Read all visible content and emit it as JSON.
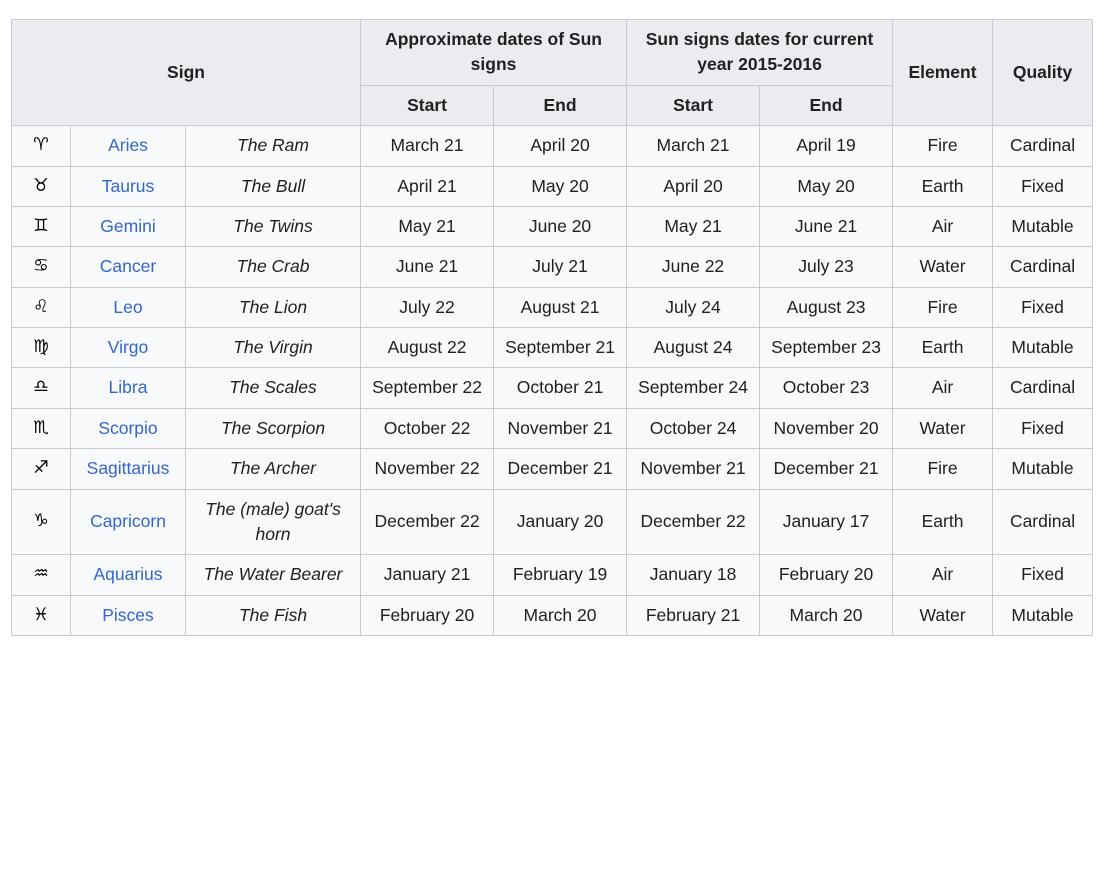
{
  "table": {
    "headers": {
      "sign": "Sign",
      "approx_dates": "Approximate dates of Sun signs",
      "current_year_dates": "Sun signs dates for current year 2015-2016",
      "element": "Element",
      "quality": "Quality",
      "approx_start": "Start",
      "approx_end": "End",
      "current_start": "Start",
      "current_end": "End"
    },
    "colors": {
      "link": "#3366cc",
      "header_bg": "#eaecf0",
      "cell_bg": "#f8f9fa",
      "outer_border": "#a2a9b1",
      "inner_border": "#c8ccd1",
      "text": "#202122"
    },
    "rows": [
      {
        "glyph": "♈",
        "glyph_name": "aries-symbol",
        "sign": "Aries",
        "meaning": "The Ram",
        "approx_start": "March 21",
        "approx_end": "April 20",
        "current_start": "March 21",
        "current_end": "April 19",
        "element": "Fire",
        "quality": "Cardinal"
      },
      {
        "glyph": "♉",
        "glyph_name": "taurus-symbol",
        "sign": "Taurus",
        "meaning": "The Bull",
        "approx_start": "April 21",
        "approx_end": "May 20",
        "current_start": "April 20",
        "current_end": "May 20",
        "element": "Earth",
        "quality": "Fixed"
      },
      {
        "glyph": "♊",
        "glyph_name": "gemini-symbol",
        "sign": "Gemini",
        "meaning": "The Twins",
        "approx_start": "May 21",
        "approx_end": "June 20",
        "current_start": "May 21",
        "current_end": "June 21",
        "element": "Air",
        "quality": "Mutable"
      },
      {
        "glyph": "♋",
        "glyph_name": "cancer-symbol",
        "sign": "Cancer",
        "meaning": "The Crab",
        "approx_start": "June 21",
        "approx_end": "July 21",
        "current_start": "June 22",
        "current_end": "July 23",
        "element": "Water",
        "quality": "Cardinal"
      },
      {
        "glyph": "♌",
        "glyph_name": "leo-symbol",
        "sign": "Leo",
        "meaning": "The Lion",
        "approx_start": "July 22",
        "approx_end": "August 21",
        "current_start": "July 24",
        "current_end": "August 23",
        "element": "Fire",
        "quality": "Fixed"
      },
      {
        "glyph": "♍",
        "glyph_name": "virgo-symbol",
        "sign": "Virgo",
        "meaning": "The Virgin",
        "approx_start": "August 22",
        "approx_end": "September 21",
        "current_start": "August 24",
        "current_end": "September 23",
        "element": "Earth",
        "quality": "Mutable"
      },
      {
        "glyph": "♎",
        "glyph_name": "libra-symbol",
        "sign": "Libra",
        "meaning": "The Scales",
        "approx_start": "September 22",
        "approx_end": "October 21",
        "current_start": "September 24",
        "current_end": "October 23",
        "element": "Air",
        "quality": "Cardinal"
      },
      {
        "glyph": "♏",
        "glyph_name": "scorpio-symbol",
        "sign": "Scorpio",
        "meaning": "The Scorpion",
        "approx_start": "October 22",
        "approx_end": "November 21",
        "current_start": "October 24",
        "current_end": "November 20",
        "element": "Water",
        "quality": "Fixed"
      },
      {
        "glyph": "♐",
        "glyph_name": "sagittarius-symbol",
        "sign": "Sagittarius",
        "meaning": "The Archer",
        "approx_start": "November 22",
        "approx_end": "December 21",
        "current_start": "November 21",
        "current_end": "December 21",
        "element": "Fire",
        "quality": "Mutable"
      },
      {
        "glyph": "♑",
        "glyph_name": "capricorn-symbol",
        "sign": "Capricorn",
        "meaning": "The (male) goat's horn",
        "approx_start": "December 22",
        "approx_end": "January 20",
        "current_start": "December 22",
        "current_end": "January 17",
        "element": "Earth",
        "quality": "Cardinal"
      },
      {
        "glyph": "♒",
        "glyph_name": "aquarius-symbol",
        "sign": "Aquarius",
        "meaning": "The Water Bearer",
        "approx_start": "January 21",
        "approx_end": "February 19",
        "current_start": "January 18",
        "current_end": "February 20",
        "element": "Air",
        "quality": "Fixed"
      },
      {
        "glyph": "♓",
        "glyph_name": "pisces-symbol",
        "sign": "Pisces",
        "meaning": "The Fish",
        "approx_start": "February 20",
        "approx_end": "March 20",
        "current_start": "February 21",
        "current_end": "March 20",
        "element": "Water",
        "quality": "Mutable"
      }
    ]
  }
}
